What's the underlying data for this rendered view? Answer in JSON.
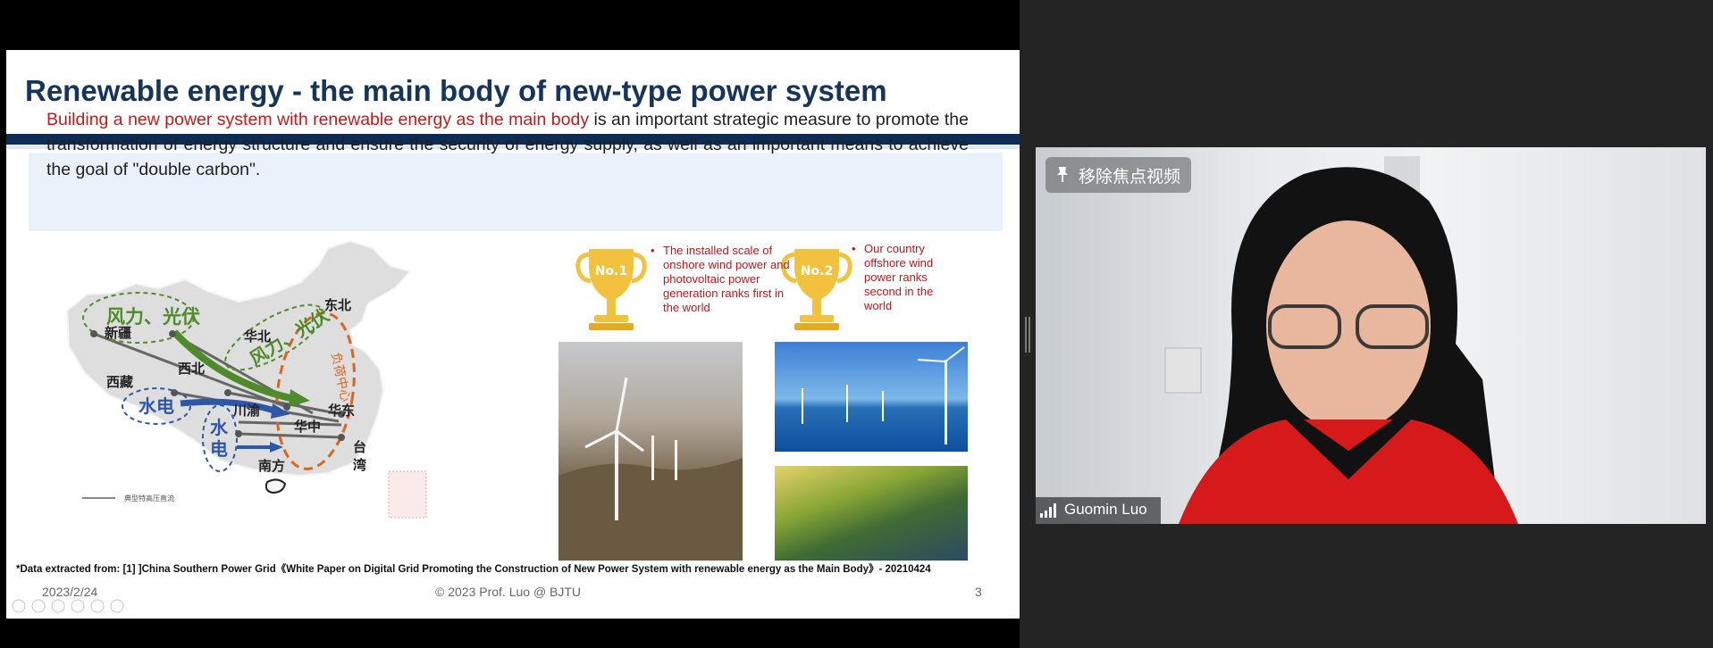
{
  "slide": {
    "title": "Renewable energy - the main body of new-type power system",
    "intro_highlight": "Building a new power system with renewable energy as the main body",
    "intro_rest": " is an important strategic measure to promote the transformation of energy structure and ensure the security of energy supply, as well as an important means to achieve the goal of \"double carbon\".",
    "map_labels": {
      "wind_solar_nw": "风力、光伏",
      "wind_solar_n": "风力、光伏",
      "hydro_sw": "水电",
      "hydro_s1": "水",
      "hydro_s2": "电",
      "load_center": "负荷中心",
      "xinjiang": "新疆",
      "xizang": "西藏",
      "xibei": "西北",
      "huabei": "华北",
      "dongbei": "东北",
      "chuanyu": "川渝",
      "huazhong": "华中",
      "huadong": "华东",
      "nanfang": "南方",
      "taiwan1": "台",
      "taiwan2": "湾",
      "legend": "典型特高压直流"
    },
    "trophies": [
      {
        "badge": "No.1",
        "text": "The installed scale of onshore wind power and photovoltaic power generation ranks first in the world"
      },
      {
        "badge": "No.2",
        "text": "Our country offshore wind power ranks second in the world"
      }
    ],
    "bullet": "•",
    "footnote": "*Data extracted from:   [1] ]China Southern Power Grid《White Paper on Digital Grid Promoting the Construction of New Power System with renewable energy as the Main Body》- 20210424",
    "date": "2023/2/24",
    "footer": "© 2023 Prof. Luo @ BJTU",
    "page_number": "3"
  },
  "video": {
    "unpin_label": "移除焦点视频",
    "participant_name": "Guomin Luo",
    "icons": [
      "pin-icon",
      "signal-icon"
    ]
  },
  "colors": {
    "title": "#17345a",
    "highlight": "#c01b1b",
    "title_bar": "#0d2c55",
    "trophy": "#f2c23e",
    "wind_green": "#4f8a2b",
    "hydro_blue": "#2f57a8",
    "load_orange": "#d8661e"
  }
}
